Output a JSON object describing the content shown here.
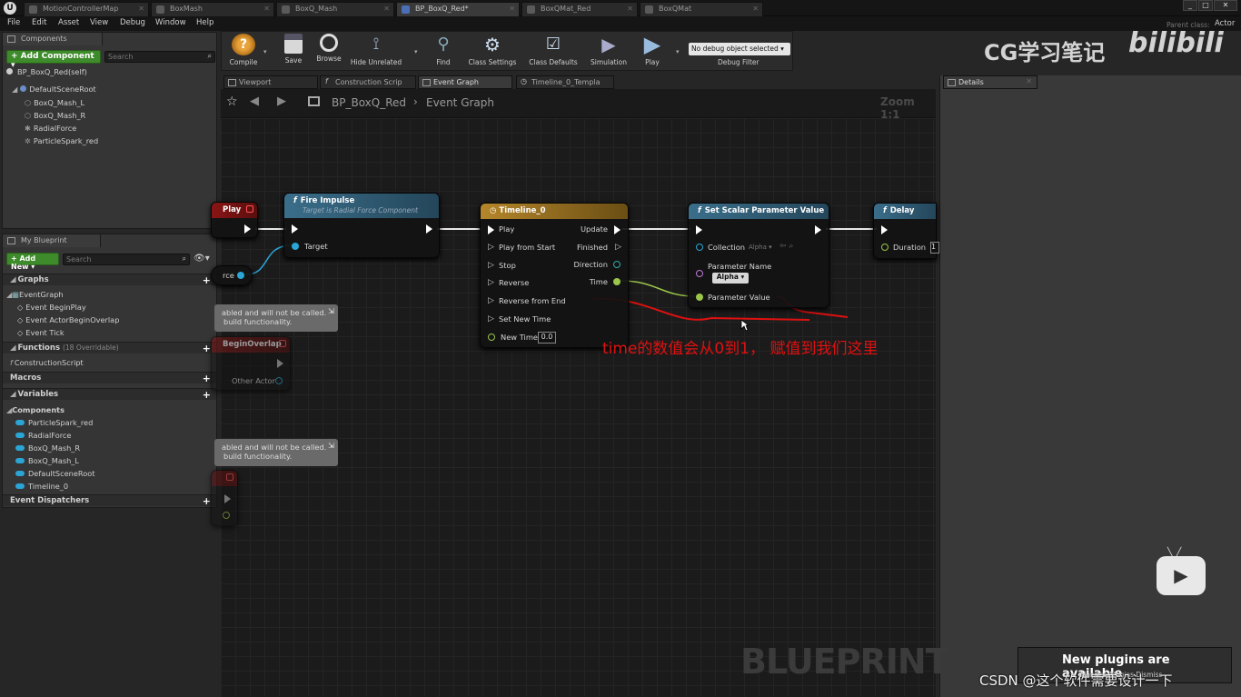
{
  "doc_tabs": [
    {
      "label": "MotionControllerMap",
      "active": false
    },
    {
      "label": "BoxMash",
      "active": false
    },
    {
      "label": "BoxQ_Mash",
      "active": false
    },
    {
      "label": "BP_BoxQ_Red*",
      "active": true
    },
    {
      "label": "BoxQMat_Red",
      "active": false
    },
    {
      "label": "BoxQMat",
      "active": false
    }
  ],
  "parent_class": {
    "label": "Parent class:",
    "value": "Actor"
  },
  "menu": [
    "File",
    "Edit",
    "Asset",
    "View",
    "Debug",
    "Window",
    "Help"
  ],
  "components": {
    "title": "Components",
    "add_label": "+ Add Component ▾",
    "search_placeholder": "Search",
    "self": "BP_BoxQ_Red(self)",
    "root": "DefaultSceneRoot",
    "children": [
      "BoxQ_Mash_L",
      "BoxQ_Mash_R",
      "RadialForce",
      "ParticleSpark_red"
    ]
  },
  "my_blueprint": {
    "title": "My Blueprint",
    "add_label": "+ Add New ▾",
    "search_placeholder": "Search",
    "graphs_label": "Graphs",
    "event_graph": "EventGraph",
    "events": [
      "Event BeginPlay",
      "Event ActorBeginOverlap",
      "Event Tick"
    ],
    "functions_label": "Functions",
    "functions_note": "(18 Overridable)",
    "construction": "ConstructionScript",
    "macros_label": "Macros",
    "variables_label": "Variables",
    "components_label": "Components",
    "vars": [
      "ParticleSpark_red",
      "RadialForce",
      "BoxQ_Mash_R",
      "BoxQ_Mash_L",
      "DefaultSceneRoot",
      "Timeline_0"
    ],
    "dispatchers_label": "Event Dispatchers"
  },
  "toolbar": [
    {
      "label": "Compile",
      "icon": "gear-question-icon"
    },
    {
      "label": "Save",
      "icon": "floppy-icon"
    },
    {
      "label": "Browse",
      "icon": "magnifier-icon"
    },
    {
      "label": "Hide Unrelated",
      "icon": "nodes-icon"
    },
    {
      "label": "Find",
      "icon": "binoculars-icon"
    },
    {
      "label": "Class Settings",
      "icon": "gears-icon"
    },
    {
      "label": "Class Defaults",
      "icon": "checklist-icon"
    },
    {
      "label": "Simulation",
      "icon": "sim-icon"
    },
    {
      "label": "Play",
      "icon": "play-icon"
    }
  ],
  "debug": {
    "select": "No debug object selected ▾",
    "label": "Debug Filter"
  },
  "editor_tabs": [
    {
      "label": "Viewport",
      "active": false
    },
    {
      "label": "Construction Scrip",
      "active": false
    },
    {
      "label": "Event Graph",
      "active": true
    },
    {
      "label": "Timeline_0_Templa",
      "active": false
    }
  ],
  "details_tab": "Details",
  "breadcrumb": {
    "root": "BP_BoxQ_Red",
    "sep": "›",
    "current": "Event Graph"
  },
  "zoom": "Zoom 1:1",
  "watermark": "BLUEPRINT",
  "nodes": {
    "begin_play": {
      "title": "Play"
    },
    "fire_impulse": {
      "title": "Fire Impulse",
      "subtitle": "Target is Radial Force Component",
      "pin_target": "Target"
    },
    "force_pin": "rce",
    "disabled1": {
      "line1": "abled and will not be called.",
      "line2": "build functionality."
    },
    "disabled2": {
      "line1": "abled and will not be called.",
      "line2": "build functionality."
    },
    "begin_overlap": {
      "title": "BeginOverlap",
      "pin": "Other Actor"
    },
    "timeline": {
      "title": "Timeline_0",
      "inputs": [
        "Play",
        "Play from Start",
        "Stop",
        "Reverse",
        "Reverse from End",
        "Set New Time",
        "New Time"
      ],
      "outputs": [
        "Update",
        "Finished",
        "Direction",
        "Time"
      ],
      "new_time_value": "0.0"
    },
    "set_scalar": {
      "title": "Set Scalar Parameter Value",
      "collection": "Collection",
      "collection_value": "Alpha ▾",
      "param_name": "Parameter Name",
      "param_name_value": "Alpha ▾",
      "param_value": "Parameter Value"
    },
    "delay": {
      "title": "Delay",
      "duration": "Duration",
      "duration_value": "1"
    }
  },
  "annotation": "time的数值会从0到1，  赋值到我们这里",
  "overlay": {
    "brand": "CG学习笔记",
    "logo": "bilibili",
    "toast": "New plugins are available",
    "toast_sub": "Manage Plugins  Dismiss",
    "csdn": "CSDN @这个软件需要设计一下"
  }
}
